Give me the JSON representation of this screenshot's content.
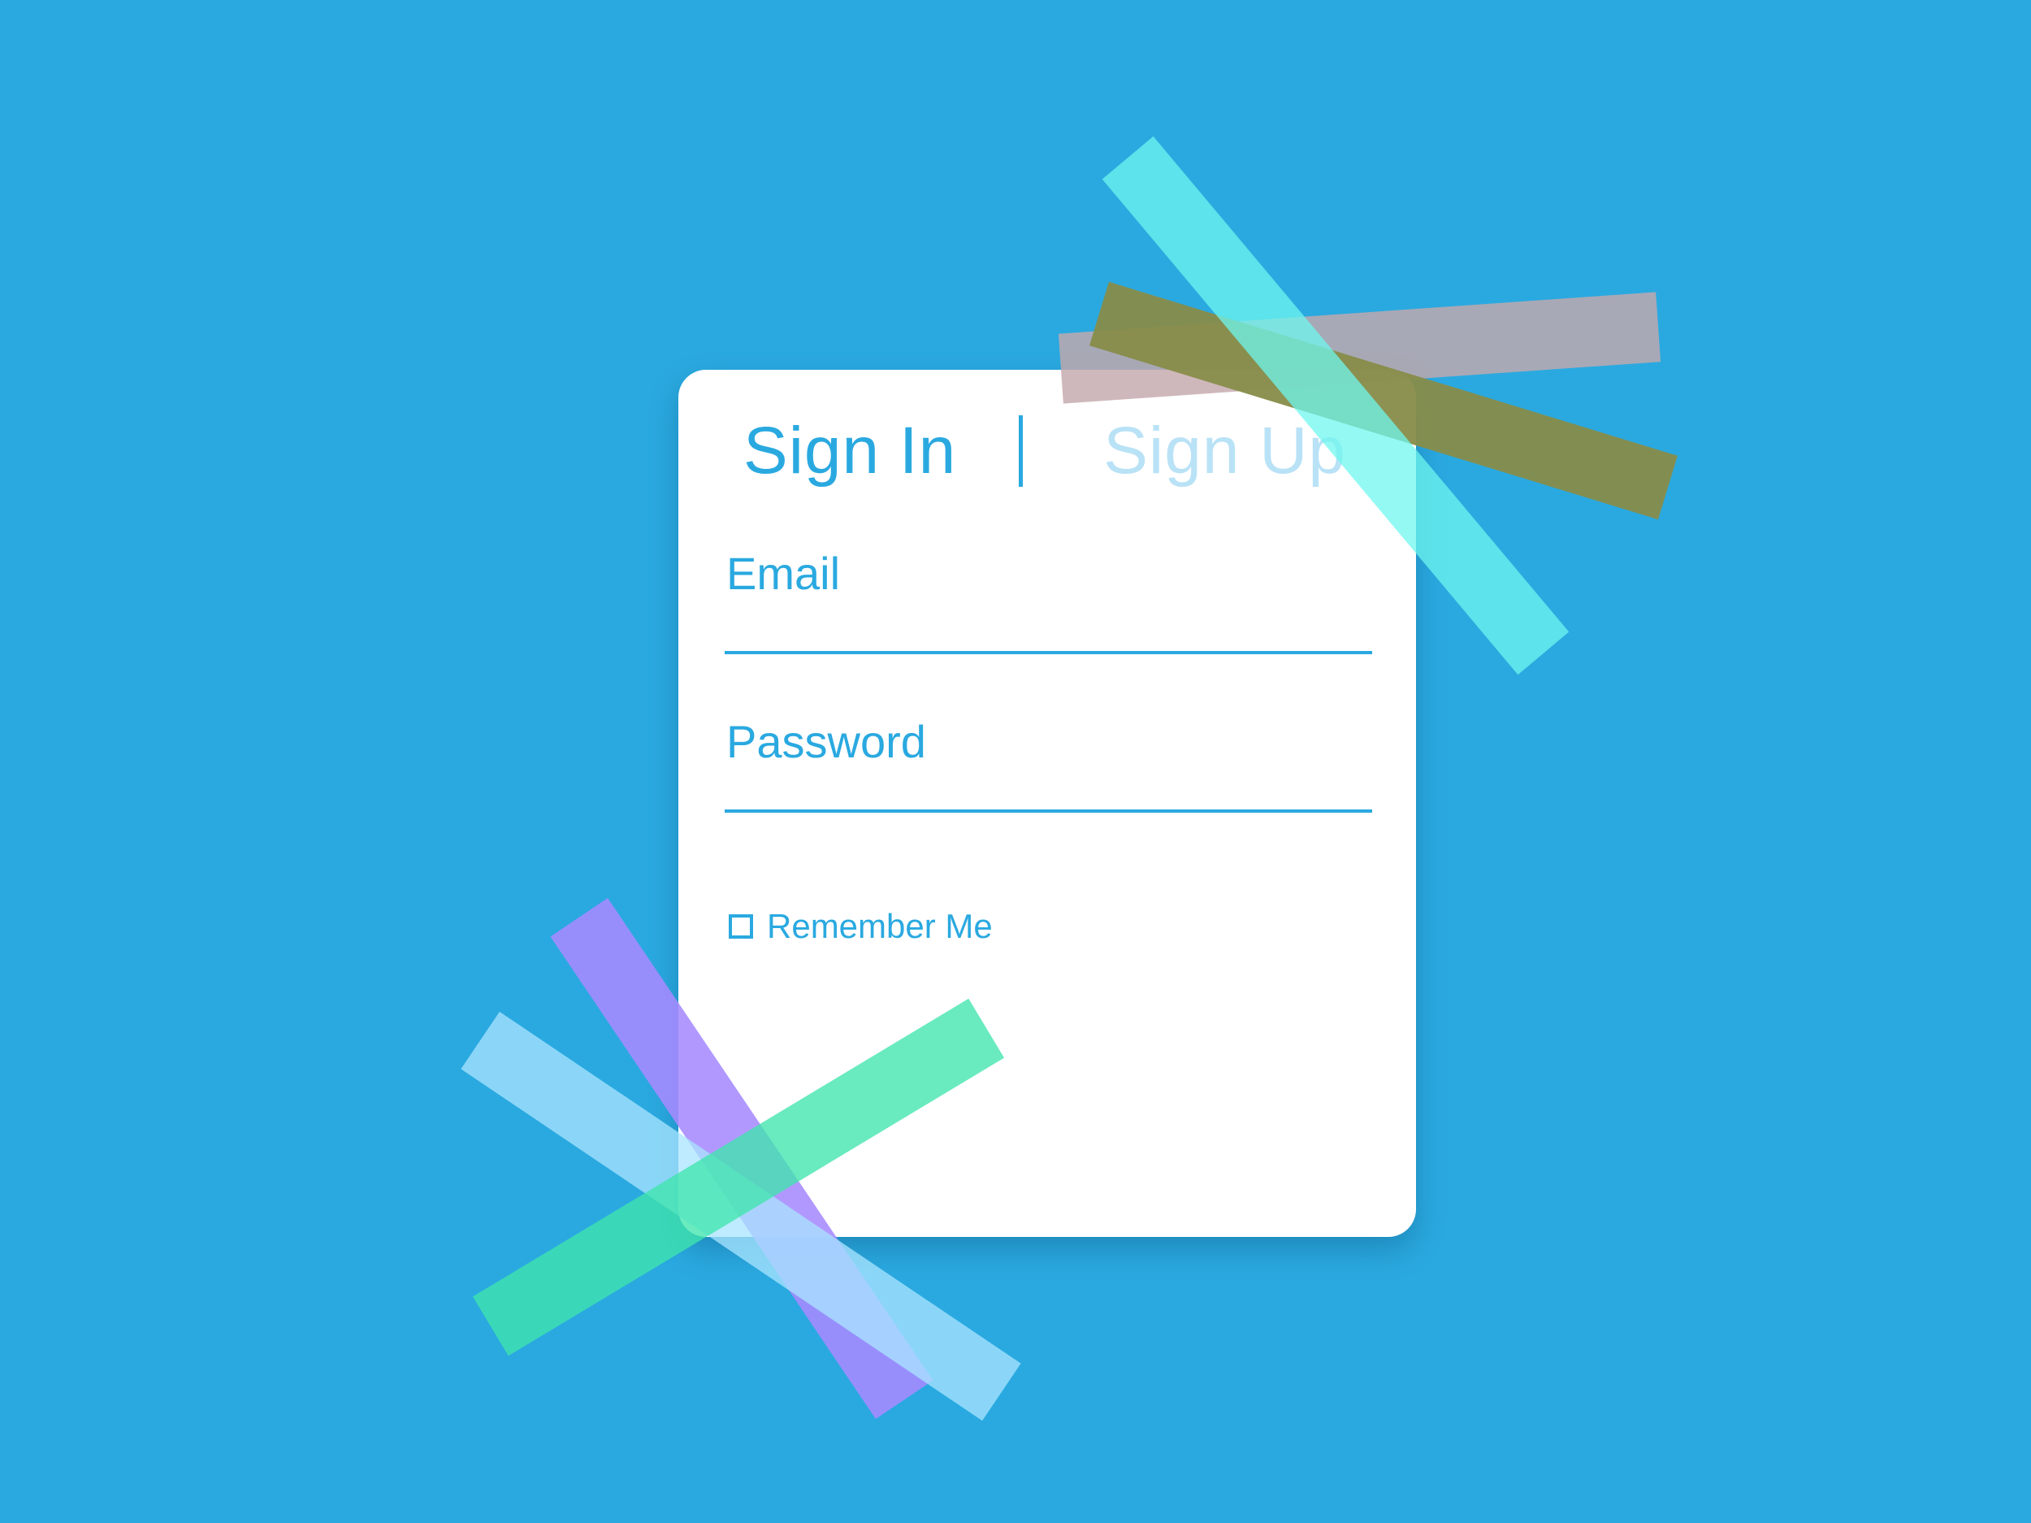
{
  "sign_in_form": {
    "tabs": {
      "sign_in_label": "Sign In",
      "separator": "|",
      "sign_up_label": "Sign Up"
    },
    "email": {
      "label": "Email",
      "value": "",
      "placeholder": ""
    },
    "password": {
      "label": "Password",
      "value": "",
      "placeholder": ""
    },
    "remember_me": {
      "label": "Remember Me",
      "checked": false
    }
  },
  "colors": {
    "background": "#2aa9e0",
    "card": "#ffffff",
    "accent": "#2aa9e0",
    "inactive_tab": "#b9e2f6",
    "olive_tape": "#878c49",
    "mauve_tape": "#c5a8ac",
    "cyan_tape": "#6ff7ef",
    "purple_tape": "#a68aff",
    "light_blue_tape": "#a9e5ff",
    "green_tape": "#3fe5ad"
  },
  "icons": {
    "checkbox": "unchecked-checkbox-icon"
  }
}
